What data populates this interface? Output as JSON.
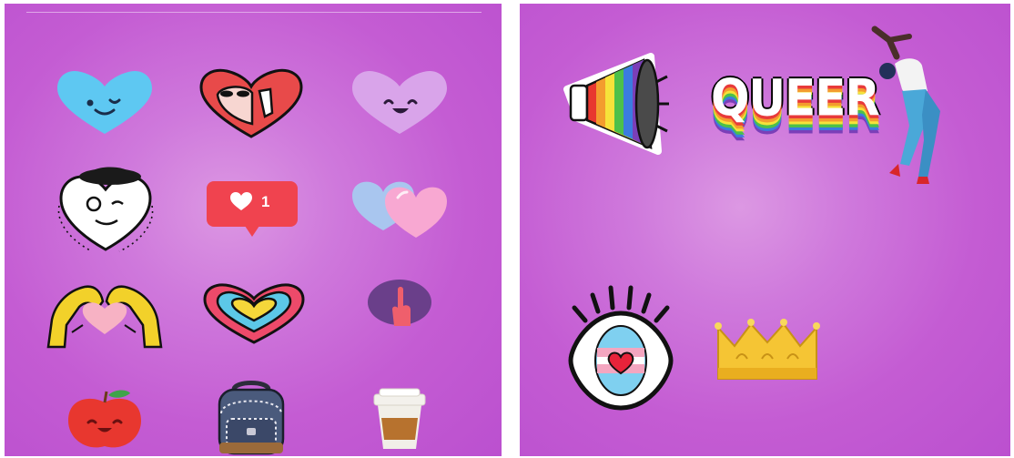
{
  "left_panel": {
    "stickers": [
      {
        "name": "blue-heart-wink-sticker"
      },
      {
        "name": "red-heart-character-sticker"
      },
      {
        "name": "purple-heart-smile-sticker"
      },
      {
        "name": "heart-face-hat-sticker"
      },
      {
        "name": "like-notification-sticker",
        "count": "1",
        "color": "#f0434f"
      },
      {
        "name": "two-hearts-sticker"
      },
      {
        "name": "hands-heart-sticker"
      },
      {
        "name": "layered-heart-sticker"
      },
      {
        "name": "pointing-finger-sticker"
      },
      {
        "name": "apple-sticker"
      },
      {
        "name": "backpack-sticker"
      },
      {
        "name": "coffee-cup-sticker"
      }
    ]
  },
  "right_panel": {
    "stickers": [
      {
        "name": "rainbow-megaphone-sticker"
      },
      {
        "name": "queer-text-sticker",
        "text": "QUEER"
      },
      {
        "name": "dancer-sticker"
      },
      {
        "name": "trans-eye-sticker"
      },
      {
        "name": "crown-sticker"
      }
    ]
  },
  "colors": {
    "background_edge": "#bb50cf",
    "background_center": "#dc98e3",
    "like_red": "#f0434f",
    "heart_blue": "#5ec8f2"
  }
}
